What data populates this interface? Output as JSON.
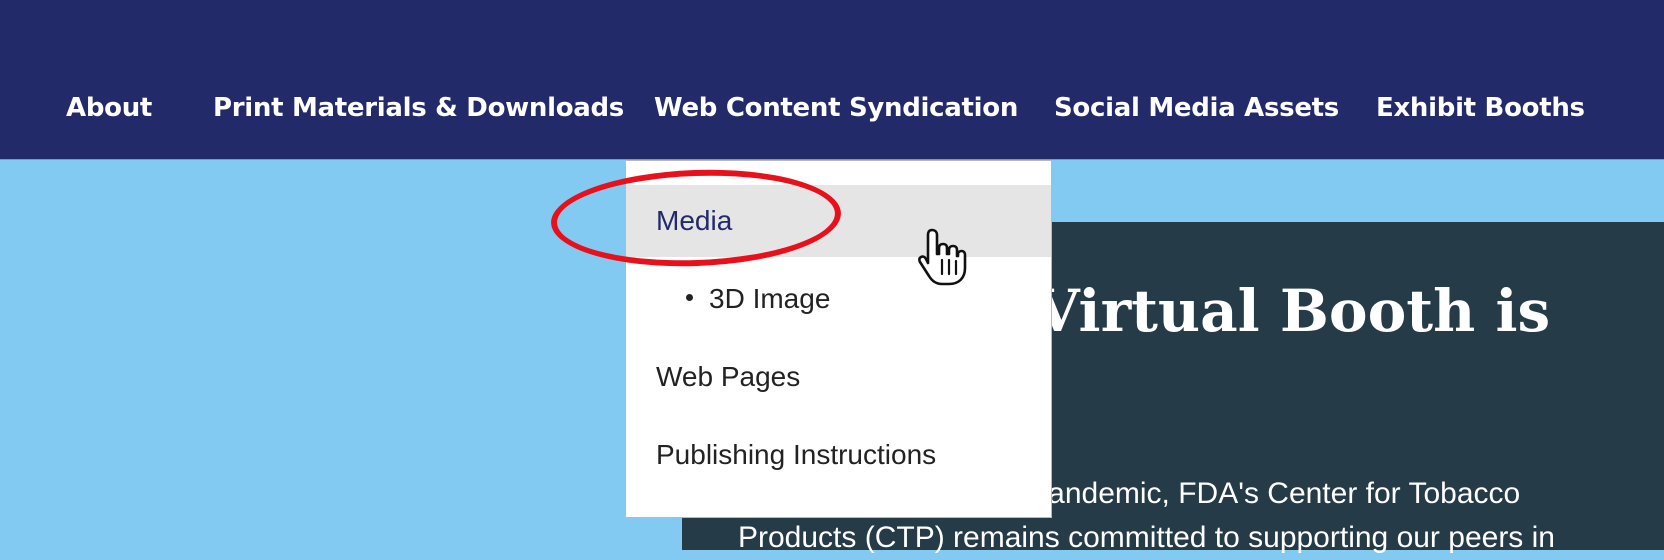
{
  "nav": {
    "items": [
      {
        "label": "About"
      },
      {
        "label": "Print Materials & Downloads"
      },
      {
        "label": "Web Content Syndication"
      },
      {
        "label": "Social Media Assets"
      },
      {
        "label": "Exhibit Booths"
      }
    ]
  },
  "dropdown": {
    "items": [
      {
        "label": "Media",
        "active": true
      },
      {
        "label": "3D Image",
        "sub": true
      },
      {
        "label": "Web Pages"
      },
      {
        "label": "Publishing Instructions"
      }
    ]
  },
  "hero": {
    "title": "Our CTP Virtual Booth is Open!",
    "body": "Due to the COVID-19 pandemic, FDA's Center for Tobacco Products (CTP) remains committed to supporting our peers in"
  },
  "colors": {
    "navbar": "#232a69",
    "page_background": "#82caf2",
    "hero_background": "#263b48",
    "annotation": "#e8101a",
    "active_item_background": "#e5e5e5"
  },
  "icons": {
    "cursor": "hand-pointer-icon"
  }
}
